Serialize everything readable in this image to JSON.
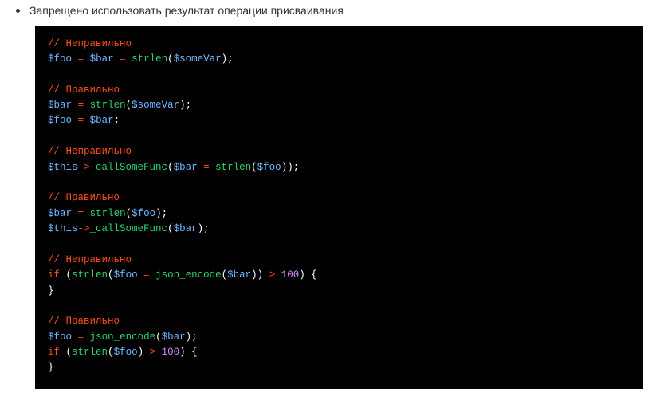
{
  "bullet": {
    "text": "Запрещено использовать результат операции присваивания"
  },
  "code": {
    "lines": [
      [
        {
          "t": "// Неправильно",
          "c": "c-comment"
        }
      ],
      [
        {
          "t": "$foo",
          "c": "c-var"
        },
        {
          "t": " ",
          "c": "c-punct"
        },
        {
          "t": "=",
          "c": "c-op"
        },
        {
          "t": " ",
          "c": "c-punct"
        },
        {
          "t": "$bar",
          "c": "c-var"
        },
        {
          "t": " ",
          "c": "c-punct"
        },
        {
          "t": "=",
          "c": "c-op"
        },
        {
          "t": " ",
          "c": "c-punct"
        },
        {
          "t": "strlen",
          "c": "c-func"
        },
        {
          "t": "(",
          "c": "c-punct"
        },
        {
          "t": "$someVar",
          "c": "c-var"
        },
        {
          "t": ");",
          "c": "c-punct"
        }
      ],
      [
        {
          "t": "",
          "c": "c-punct"
        }
      ],
      [
        {
          "t": "// Правильно",
          "c": "c-comment"
        }
      ],
      [
        {
          "t": "$bar",
          "c": "c-var"
        },
        {
          "t": " ",
          "c": "c-punct"
        },
        {
          "t": "=",
          "c": "c-op"
        },
        {
          "t": " ",
          "c": "c-punct"
        },
        {
          "t": "strlen",
          "c": "c-func"
        },
        {
          "t": "(",
          "c": "c-punct"
        },
        {
          "t": "$someVar",
          "c": "c-var"
        },
        {
          "t": ");",
          "c": "c-punct"
        }
      ],
      [
        {
          "t": "$foo",
          "c": "c-var"
        },
        {
          "t": " ",
          "c": "c-punct"
        },
        {
          "t": "=",
          "c": "c-op"
        },
        {
          "t": " ",
          "c": "c-punct"
        },
        {
          "t": "$bar",
          "c": "c-var"
        },
        {
          "t": ";",
          "c": "c-punct"
        }
      ],
      [
        {
          "t": "",
          "c": "c-punct"
        }
      ],
      [
        {
          "t": "// Неправильно",
          "c": "c-comment"
        }
      ],
      [
        {
          "t": "$this",
          "c": "c-var"
        },
        {
          "t": "->",
          "c": "c-op"
        },
        {
          "t": "_callSomeFunc",
          "c": "c-func"
        },
        {
          "t": "(",
          "c": "c-punct"
        },
        {
          "t": "$bar",
          "c": "c-var"
        },
        {
          "t": " ",
          "c": "c-punct"
        },
        {
          "t": "=",
          "c": "c-op"
        },
        {
          "t": " ",
          "c": "c-punct"
        },
        {
          "t": "strlen",
          "c": "c-func"
        },
        {
          "t": "(",
          "c": "c-punct"
        },
        {
          "t": "$foo",
          "c": "c-var"
        },
        {
          "t": "));",
          "c": "c-punct"
        }
      ],
      [
        {
          "t": "",
          "c": "c-punct"
        }
      ],
      [
        {
          "t": "// Правильно",
          "c": "c-comment"
        }
      ],
      [
        {
          "t": "$bar",
          "c": "c-var"
        },
        {
          "t": " ",
          "c": "c-punct"
        },
        {
          "t": "=",
          "c": "c-op"
        },
        {
          "t": " ",
          "c": "c-punct"
        },
        {
          "t": "strlen",
          "c": "c-func"
        },
        {
          "t": "(",
          "c": "c-punct"
        },
        {
          "t": "$foo",
          "c": "c-var"
        },
        {
          "t": ");",
          "c": "c-punct"
        }
      ],
      [
        {
          "t": "$this",
          "c": "c-var"
        },
        {
          "t": "->",
          "c": "c-op"
        },
        {
          "t": "_callSomeFunc",
          "c": "c-func"
        },
        {
          "t": "(",
          "c": "c-punct"
        },
        {
          "t": "$bar",
          "c": "c-var"
        },
        {
          "t": ");",
          "c": "c-punct"
        }
      ],
      [
        {
          "t": "",
          "c": "c-punct"
        }
      ],
      [
        {
          "t": "// Неправильно",
          "c": "c-comment"
        }
      ],
      [
        {
          "t": "if",
          "c": "c-kw"
        },
        {
          "t": " (",
          "c": "c-punct"
        },
        {
          "t": "strlen",
          "c": "c-func"
        },
        {
          "t": "(",
          "c": "c-punct"
        },
        {
          "t": "$foo",
          "c": "c-var"
        },
        {
          "t": " ",
          "c": "c-punct"
        },
        {
          "t": "=",
          "c": "c-op"
        },
        {
          "t": " ",
          "c": "c-punct"
        },
        {
          "t": "json_encode",
          "c": "c-func"
        },
        {
          "t": "(",
          "c": "c-punct"
        },
        {
          "t": "$bar",
          "c": "c-var"
        },
        {
          "t": ")) ",
          "c": "c-punct"
        },
        {
          "t": ">",
          "c": "c-op"
        },
        {
          "t": " ",
          "c": "c-punct"
        },
        {
          "t": "100",
          "c": "c-num"
        },
        {
          "t": ") {",
          "c": "c-punct"
        }
      ],
      [
        {
          "t": "}",
          "c": "c-punct"
        }
      ],
      [
        {
          "t": "",
          "c": "c-punct"
        }
      ],
      [
        {
          "t": "// Правильно",
          "c": "c-comment"
        }
      ],
      [
        {
          "t": "$foo",
          "c": "c-var"
        },
        {
          "t": " ",
          "c": "c-punct"
        },
        {
          "t": "=",
          "c": "c-op"
        },
        {
          "t": " ",
          "c": "c-punct"
        },
        {
          "t": "json_encode",
          "c": "c-func"
        },
        {
          "t": "(",
          "c": "c-punct"
        },
        {
          "t": "$bar",
          "c": "c-var"
        },
        {
          "t": ");",
          "c": "c-punct"
        }
      ],
      [
        {
          "t": "if",
          "c": "c-kw"
        },
        {
          "t": " (",
          "c": "c-punct"
        },
        {
          "t": "strlen",
          "c": "c-func"
        },
        {
          "t": "(",
          "c": "c-punct"
        },
        {
          "t": "$foo",
          "c": "c-var"
        },
        {
          "t": ") ",
          "c": "c-punct"
        },
        {
          "t": ">",
          "c": "c-op"
        },
        {
          "t": " ",
          "c": "c-punct"
        },
        {
          "t": "100",
          "c": "c-num"
        },
        {
          "t": ") {",
          "c": "c-punct"
        }
      ],
      [
        {
          "t": "}",
          "c": "c-punct"
        }
      ]
    ]
  }
}
